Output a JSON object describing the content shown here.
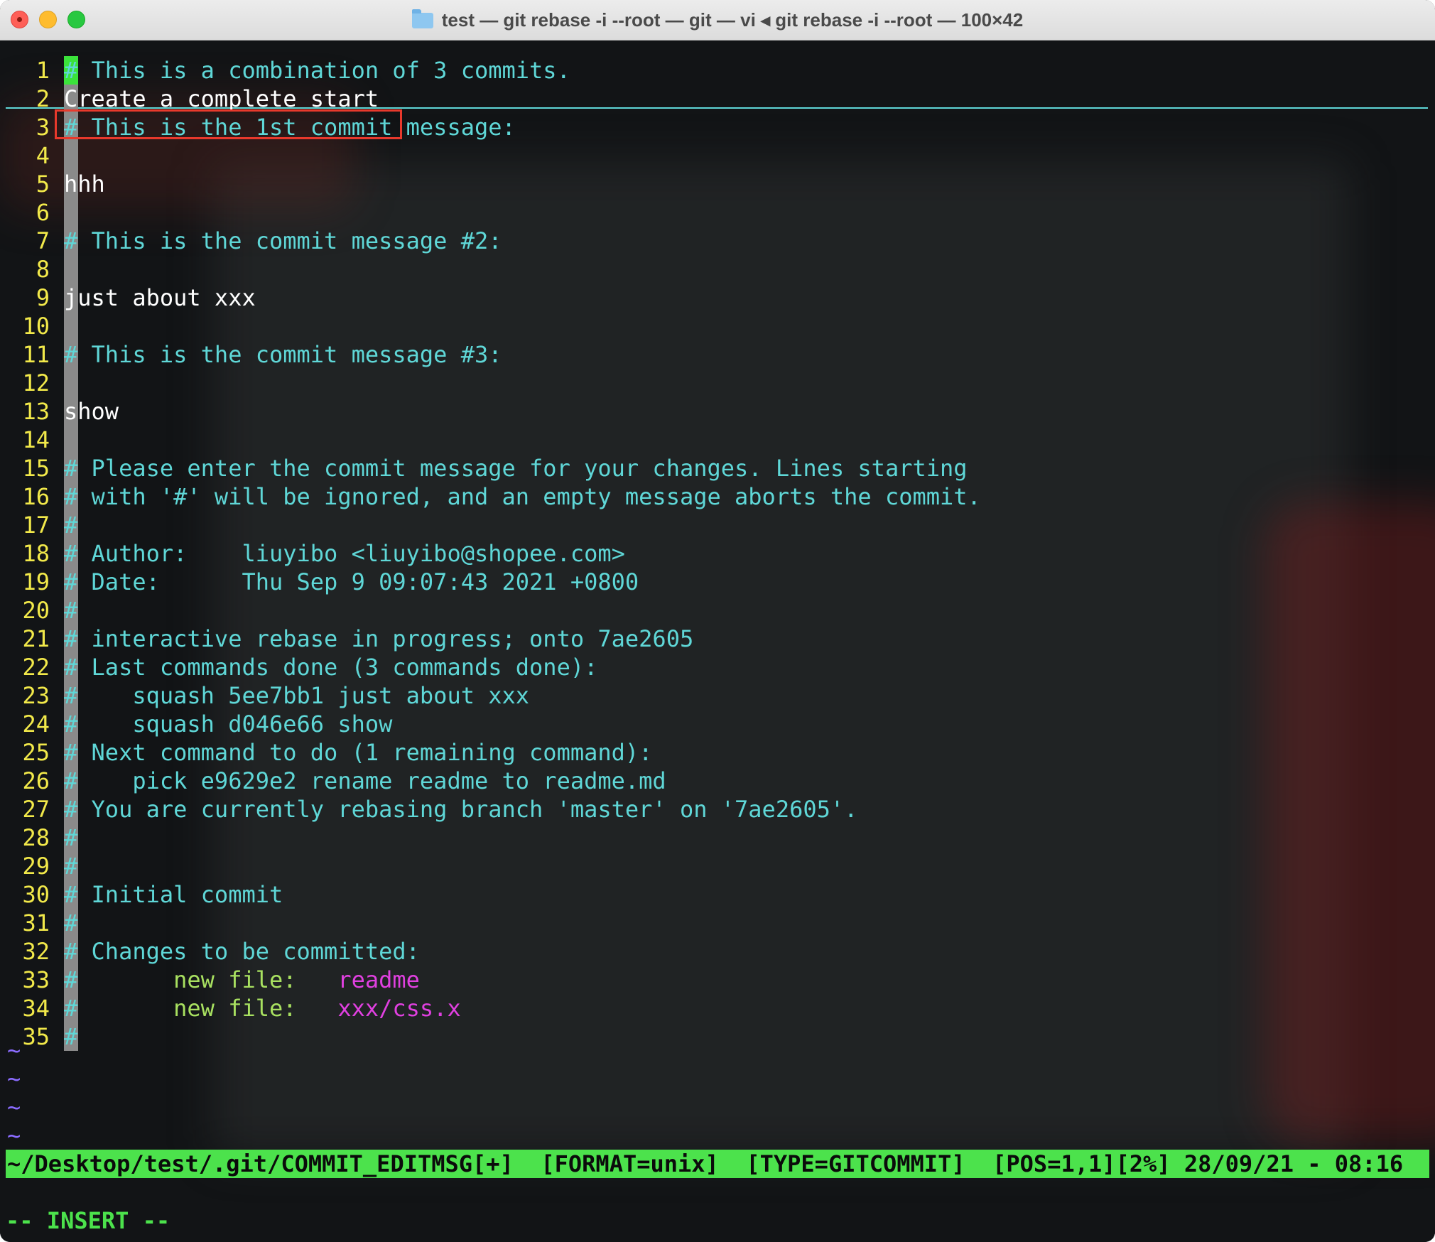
{
  "window": {
    "title": "test — git rebase -i --root — git — vi ◂ git rebase -i --root — 100×42"
  },
  "editor": {
    "lines": [
      {
        "num": "1",
        "segments": [
          {
            "t": "# This is a combination of 3 commits.",
            "c": "hash"
          }
        ]
      },
      {
        "num": "2",
        "segments": [
          {
            "t": "Create a complete start",
            "c": "text"
          }
        ]
      },
      {
        "num": "3",
        "segments": [
          {
            "t": "# This is the 1st commit message:",
            "c": "hash"
          }
        ]
      },
      {
        "num": "4",
        "segments": []
      },
      {
        "num": "5",
        "segments": [
          {
            "t": "hhh",
            "c": "text"
          }
        ]
      },
      {
        "num": "6",
        "segments": []
      },
      {
        "num": "7",
        "segments": [
          {
            "t": "# This is the commit message #2:",
            "c": "hash"
          }
        ]
      },
      {
        "num": "8",
        "segments": []
      },
      {
        "num": "9",
        "segments": [
          {
            "t": "just about xxx",
            "c": "text"
          }
        ]
      },
      {
        "num": "10",
        "segments": []
      },
      {
        "num": "11",
        "segments": [
          {
            "t": "# This is the commit message #3:",
            "c": "hash"
          }
        ]
      },
      {
        "num": "12",
        "segments": []
      },
      {
        "num": "13",
        "segments": [
          {
            "t": "show",
            "c": "text"
          }
        ]
      },
      {
        "num": "14",
        "segments": []
      },
      {
        "num": "15",
        "segments": [
          {
            "t": "# Please enter the commit message for your changes. Lines starting",
            "c": "hash"
          }
        ]
      },
      {
        "num": "16",
        "segments": [
          {
            "t": "# with '#' will be ignored, and an empty message aborts the commit.",
            "c": "hash"
          }
        ]
      },
      {
        "num": "17",
        "segments": [
          {
            "t": "#",
            "c": "hash"
          }
        ]
      },
      {
        "num": "18",
        "segments": [
          {
            "t": "# Author:    liuyibo <liuyibo@shopee.com>",
            "c": "hash"
          }
        ]
      },
      {
        "num": "19",
        "segments": [
          {
            "t": "# Date:      Thu Sep 9 09:07:43 2021 +0800",
            "c": "hash"
          }
        ]
      },
      {
        "num": "20",
        "segments": [
          {
            "t": "#",
            "c": "hash"
          }
        ]
      },
      {
        "num": "21",
        "segments": [
          {
            "t": "# interactive rebase in progress; onto 7ae2605",
            "c": "hash"
          }
        ]
      },
      {
        "num": "22",
        "segments": [
          {
            "t": "# Last commands done (3 commands done):",
            "c": "hash"
          }
        ]
      },
      {
        "num": "23",
        "segments": [
          {
            "t": "#    squash 5ee7bb1 just about xxx",
            "c": "hash"
          }
        ]
      },
      {
        "num": "24",
        "segments": [
          {
            "t": "#    squash d046e66 show",
            "c": "hash"
          }
        ]
      },
      {
        "num": "25",
        "segments": [
          {
            "t": "# Next command to do (1 remaining command):",
            "c": "hash"
          }
        ]
      },
      {
        "num": "26",
        "segments": [
          {
            "t": "#    pick e9629e2 rename readme to readme.md",
            "c": "hash"
          }
        ]
      },
      {
        "num": "27",
        "segments": [
          {
            "t": "# You are currently rebasing branch 'master' on '7ae2605'.",
            "c": "hash"
          }
        ]
      },
      {
        "num": "28",
        "segments": [
          {
            "t": "#",
            "c": "hash"
          }
        ]
      },
      {
        "num": "29",
        "segments": [
          {
            "t": "#",
            "c": "hash"
          }
        ]
      },
      {
        "num": "30",
        "segments": [
          {
            "t": "# Initial commit",
            "c": "hash"
          }
        ]
      },
      {
        "num": "31",
        "segments": [
          {
            "t": "#",
            "c": "hash"
          }
        ]
      },
      {
        "num": "32",
        "segments": [
          {
            "t": "# Changes to be committed:",
            "c": "hash"
          }
        ]
      },
      {
        "num": "33",
        "segments": [
          {
            "t": "#",
            "c": "hash"
          },
          {
            "t": "       new file:   ",
            "c": "green"
          },
          {
            "t": "readme",
            "c": "magenta"
          }
        ]
      },
      {
        "num": "34",
        "segments": [
          {
            "t": "#",
            "c": "hash"
          },
          {
            "t": "       new file:   ",
            "c": "green"
          },
          {
            "t": "xxx/css.x",
            "c": "magenta"
          }
        ]
      },
      {
        "num": "35",
        "segments": [
          {
            "t": "#",
            "c": "hash"
          }
        ]
      }
    ],
    "tildes": [
      "~",
      "~",
      "~",
      "~"
    ]
  },
  "statusbar": {
    "text": "~/Desktop/test/.git/COMMIT_EDITMSG[+]  [FORMAT=unix]  [TYPE=GITCOMMIT]  [POS=1,1][2%] 28/09/21 - 08:16"
  },
  "mode": {
    "text": "-- INSERT --"
  },
  "colors": {
    "line_number": "#f2e94a",
    "comment": "#5fd7d7",
    "text": "#ffffff",
    "new_file_label": "#a8e060",
    "file_name": "#e040e0",
    "statusbar_bg": "#4ce24c",
    "mode_text": "#4ce24c",
    "tilde": "#8b6cff",
    "highlight_box": "#e8392c"
  }
}
